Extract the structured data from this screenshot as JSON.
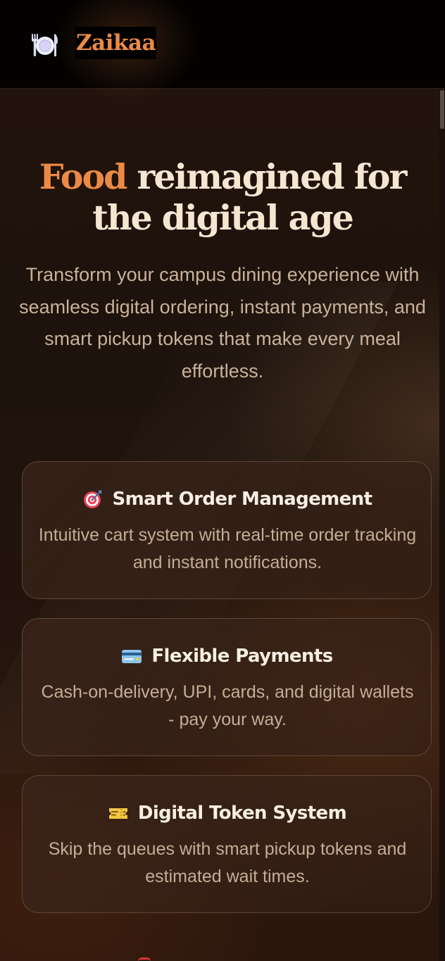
{
  "header": {
    "brand": "Zaikaa",
    "logo_icon": "plate-cutlery-icon"
  },
  "hero": {
    "title_accent": "Food",
    "title_rest": " reimagined for the digital age",
    "subtitle": "Transform your campus dining experience with seamless digital ordering, instant payments, and smart pickup tokens that make every meal effortless."
  },
  "features": [
    {
      "icon": "target-dart-icon",
      "title": "Smart Order Management",
      "description": "Intuitive cart system with real-time order tracking and instant notifications."
    },
    {
      "icon": "credit-card-icon",
      "title": "Flexible Payments",
      "description": "Cash-on-delivery, UPI, cards, and digital wallets - pay your way."
    },
    {
      "icon": "ticket-icon",
      "title": "Digital Token System",
      "description": "Skip the queues with smart pickup tokens and estimated wait times."
    }
  ],
  "colors": {
    "accent": "#ec8a45",
    "background": "#1f130d",
    "header_background": "#030201",
    "heading_text": "#f5e6d2",
    "body_text": "#c9b29a"
  }
}
